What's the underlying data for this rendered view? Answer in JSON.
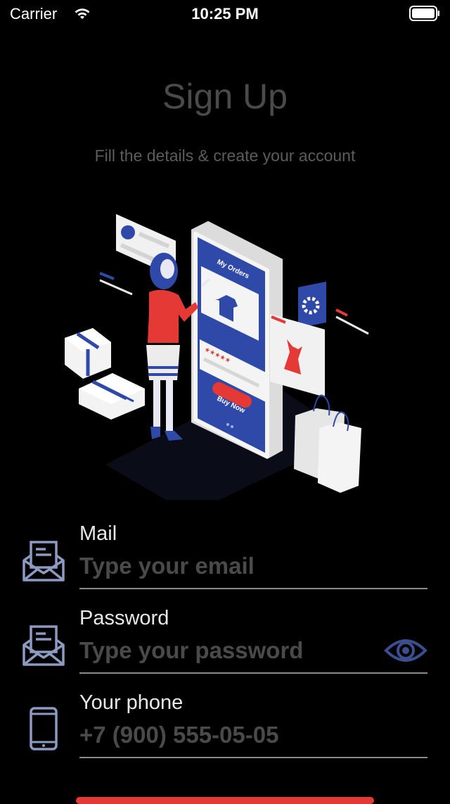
{
  "status_bar": {
    "carrier": "Carrier",
    "time": "10:25 PM"
  },
  "header": {
    "title": "Sign Up",
    "subtitle": "Fill the details & create your account"
  },
  "illustration": {
    "screen_title": "My Orders",
    "buy_button": "Buy Now"
  },
  "form": {
    "mail": {
      "label": "Mail",
      "placeholder": "Type your email",
      "value": ""
    },
    "password": {
      "label": "Password",
      "placeholder": "Type your password",
      "value": ""
    },
    "phone": {
      "label": "Your phone",
      "placeholder": "+7 (900) 555-05-05",
      "value": ""
    }
  },
  "colors": {
    "accent": "#e53935",
    "brand_blue": "#2f49a8",
    "icon_blue": "#3b4f8f"
  }
}
